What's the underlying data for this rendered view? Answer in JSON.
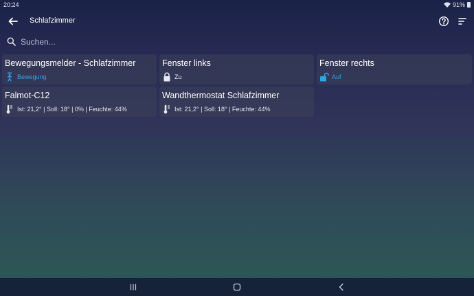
{
  "status_bar": {
    "time": "20:24",
    "battery": "91%"
  },
  "app_bar": {
    "title": "Schlafzimmer"
  },
  "search": {
    "placeholder": "Suchen..."
  },
  "cards": [
    {
      "name": "Bewegungsmelder - Schlafzimmer",
      "state": "Bewegung",
      "icon": "motion-sensor-icon"
    },
    {
      "name": "Fenster links",
      "state": "Zu",
      "icon": "lock-closed-icon"
    },
    {
      "name": "Fenster rechts",
      "state": "Auf",
      "icon": "lock-open-icon"
    },
    {
      "name": "Falmot-C12",
      "state": "Ist: 21,2° | Soll: 18° | 0% | Feuchte: 44%",
      "icon": "thermometer-icon"
    },
    {
      "name": "Wandthermostat Schlafzimmer",
      "state": "Ist: 21,2° | Soll: 18° | Feuchte: 44%",
      "icon": "thermometer-icon"
    }
  ],
  "colors": {
    "accent": "#2aa5e8",
    "card_bg": "#3c425a",
    "nav_bg": "#16213a"
  }
}
